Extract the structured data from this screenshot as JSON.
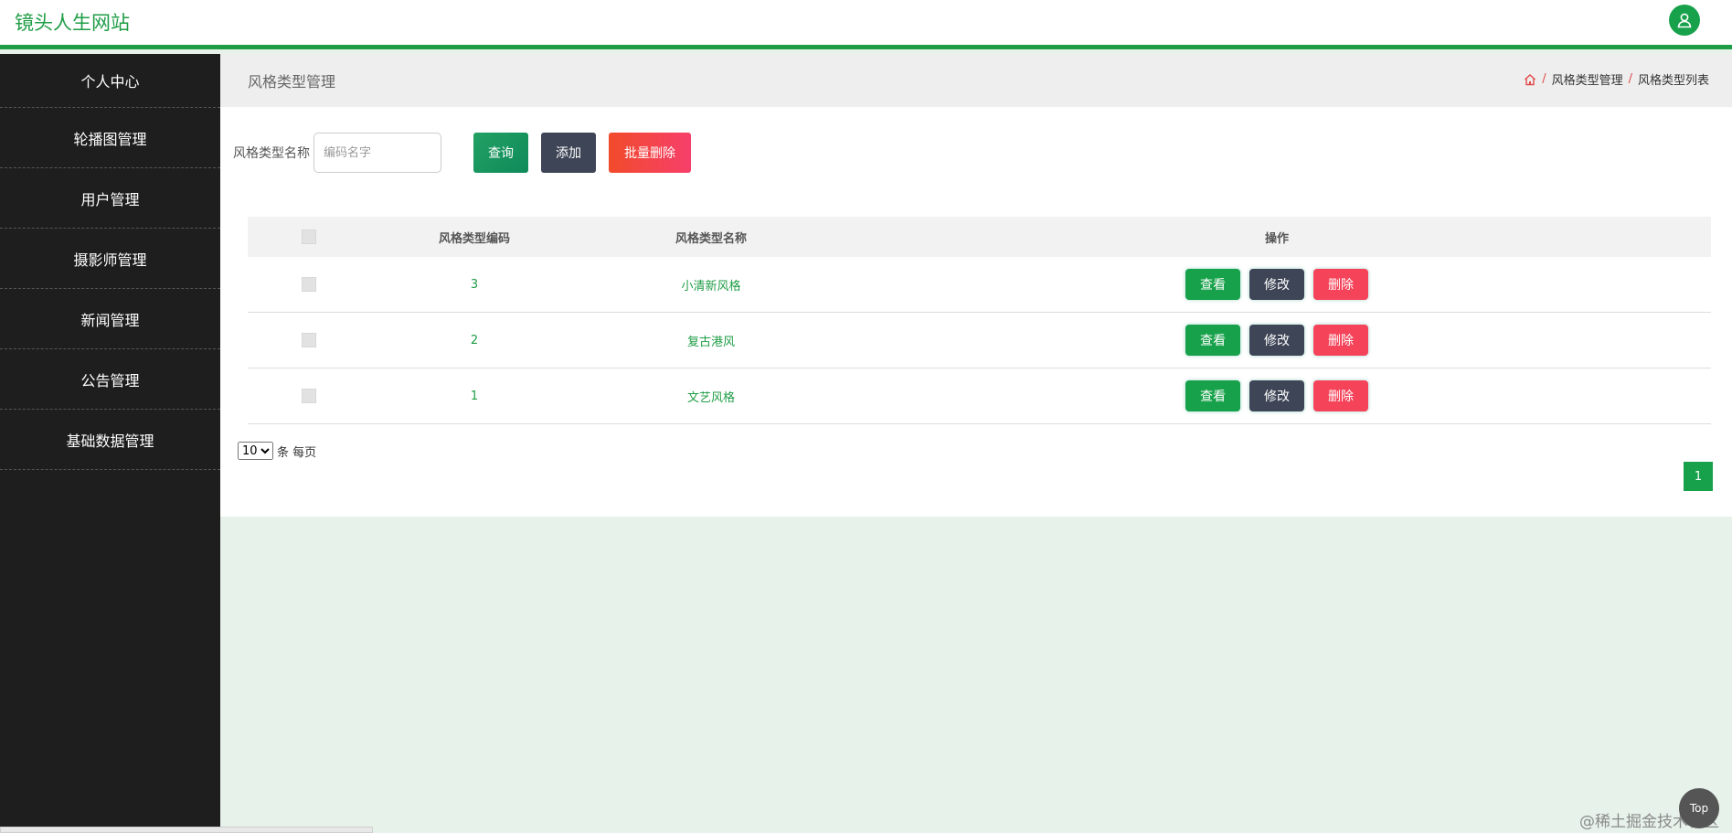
{
  "header": {
    "site_title": "镜头人生网站",
    "avatar_icon": "user-icon"
  },
  "sidebar": {
    "items": [
      {
        "label": "个人中心"
      },
      {
        "label": "轮播图管理"
      },
      {
        "label": "用户管理"
      },
      {
        "label": "摄影师管理"
      },
      {
        "label": "新闻管理"
      },
      {
        "label": "公告管理"
      },
      {
        "label": "基础数据管理"
      }
    ]
  },
  "page": {
    "title": "风格类型管理",
    "breadcrumb": {
      "home_icon": "home-icon",
      "item1": "风格类型管理",
      "item2": "风格类型列表",
      "separator": "/"
    }
  },
  "search": {
    "label": "风格类型名称",
    "placeholder": "编码名字",
    "value": "",
    "query_label": "查询",
    "add_label": "添加",
    "batch_delete_label": "批量删除"
  },
  "table": {
    "columns": {
      "code": "风格类型编码",
      "name": "风格类型名称",
      "ops": "操作"
    },
    "rows": [
      {
        "code": "3",
        "name": "小清新风格"
      },
      {
        "code": "2",
        "name": "复古港风"
      },
      {
        "code": "1",
        "name": "文艺风格"
      }
    ],
    "actions": {
      "view": "查看",
      "edit": "修改",
      "delete": "删除"
    }
  },
  "pager": {
    "page_size": "10",
    "page_size_options": [
      "10"
    ],
    "suffix": "条 每页",
    "current_page": "1"
  },
  "floating": {
    "top_label": "Top",
    "watermark": "@稀土掘金技术社区"
  },
  "colors": {
    "brand_green": "#1f9d46",
    "sidebar_bg": "#1e1e1e",
    "danger": "#f5445a",
    "dark_button": "#3e4556",
    "page_bg": "#e6f2ea"
  }
}
